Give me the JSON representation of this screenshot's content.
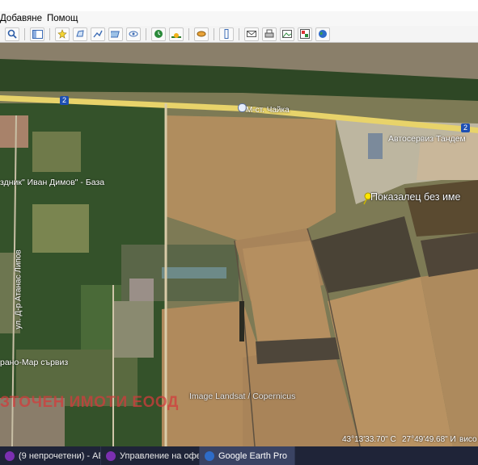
{
  "menu": {
    "items": [
      "Добавяне",
      "Помощ"
    ]
  },
  "toolbar": {
    "icons": [
      "search-icon",
      "sidebar-icon",
      "placemark-icon",
      "polygon-icon",
      "path-icon",
      "overlay-icon",
      "tour-icon",
      "historical-imagery-icon",
      "sunlight-icon",
      "planets-icon",
      "ruler-icon",
      "email-icon",
      "print-icon",
      "save-image-icon",
      "view-in-maps-icon",
      "earth-icon"
    ]
  },
  "map": {
    "road_shield_left": "2",
    "road_shield_right": "2",
    "place_moss": "М-ст. Чайка",
    "place_autoservice": "Автосервиз Тандем",
    "place_base": "здник\" Иван Димов\" - База",
    "street_label": "ул. Д-р Атанас Липов",
    "place_trans": "рано-Мар сървиз",
    "placemark_label": "Показалец без име",
    "imagery_credit": "Image Landsat / Copernicus",
    "watermark": "ЗТОЧЕН ИМОТИ ЕООД",
    "coord_lat": "43°13'33.70\" С",
    "coord_lon": "27°49'49.68\" И",
    "coord_alt": "висо"
  },
  "taskbar": {
    "items": [
      {
        "label": "(9 непрочетени) - АБ..."
      },
      {
        "label": "Управление на офер..."
      },
      {
        "label": "Google Earth Pro"
      }
    ]
  },
  "colors": {
    "road": "#e8d36a",
    "field_plowed": "#4a4336",
    "field_dry": "#b08d5e",
    "forest": "#2f4a26",
    "placemark": "#ffe600",
    "taskbar": "#1f2438"
  }
}
